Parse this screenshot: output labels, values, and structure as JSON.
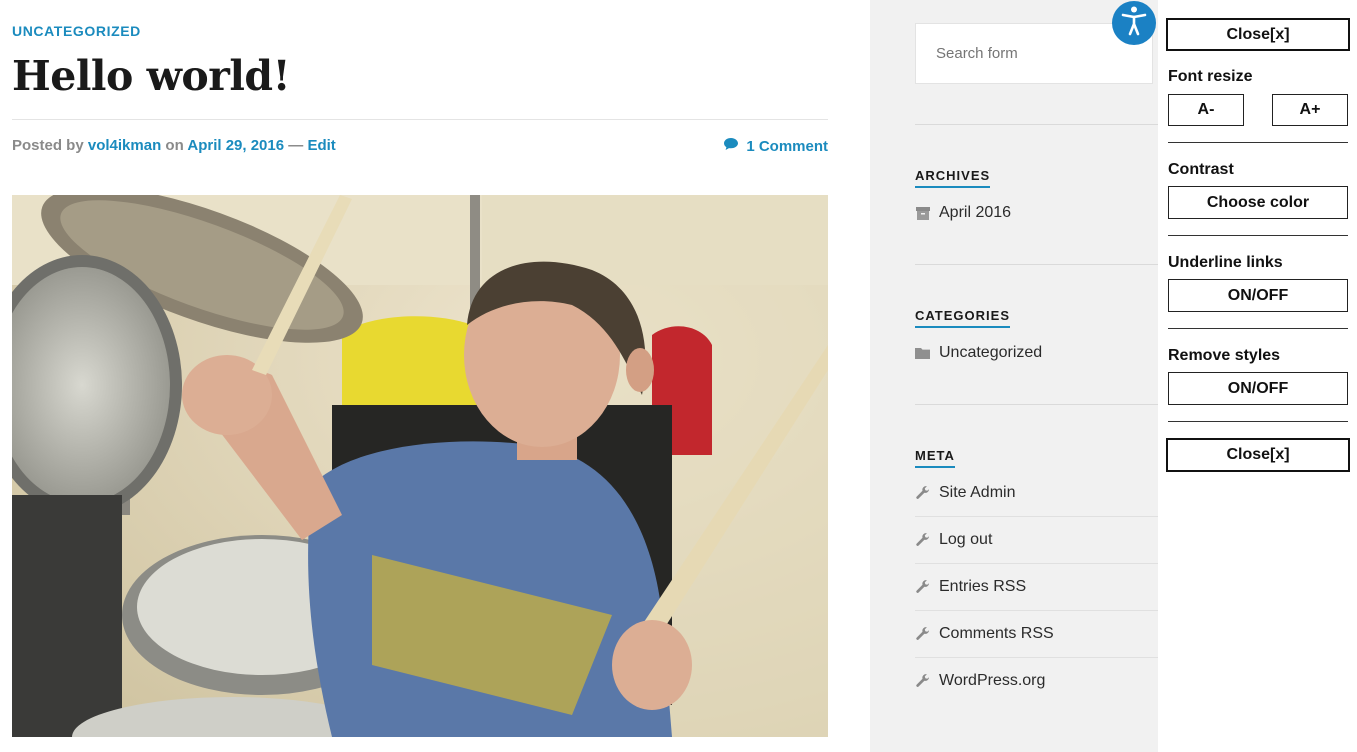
{
  "post": {
    "category": "UNCATEGORIZED",
    "title": "Hello world!",
    "posted_by": "Posted by",
    "author": "vol4ikman",
    "on": "on",
    "date": "April 29, 2016",
    "dash": "—",
    "edit": "Edit",
    "comments": "1 Comment"
  },
  "sidebar": {
    "search_placeholder": "Search form",
    "archives": {
      "heading": "ARCHIVES",
      "items": [
        "April 2016"
      ]
    },
    "categories": {
      "heading": "CATEGORIES",
      "items": [
        "Uncategorized"
      ]
    },
    "meta": {
      "heading": "META",
      "items": [
        "Site Admin",
        "Log out",
        "Entries RSS",
        "Comments RSS",
        "WordPress.org"
      ]
    }
  },
  "accessibility": {
    "close_top": "Close[x]",
    "font_resize_label": "Font resize",
    "decrease": "A-",
    "increase": "A+",
    "contrast_label": "Contrast",
    "choose_color": "Choose color",
    "underline_label": "Underline links",
    "underline_toggle": "ON/OFF",
    "remove_styles_label": "Remove styles",
    "remove_styles_toggle": "ON/OFF",
    "close_bottom": "Close[x]"
  },
  "colors": {
    "accent": "#1b8bbe",
    "a11y_button": "#1b81c4",
    "sidebar_bg": "#f1f1f1"
  }
}
